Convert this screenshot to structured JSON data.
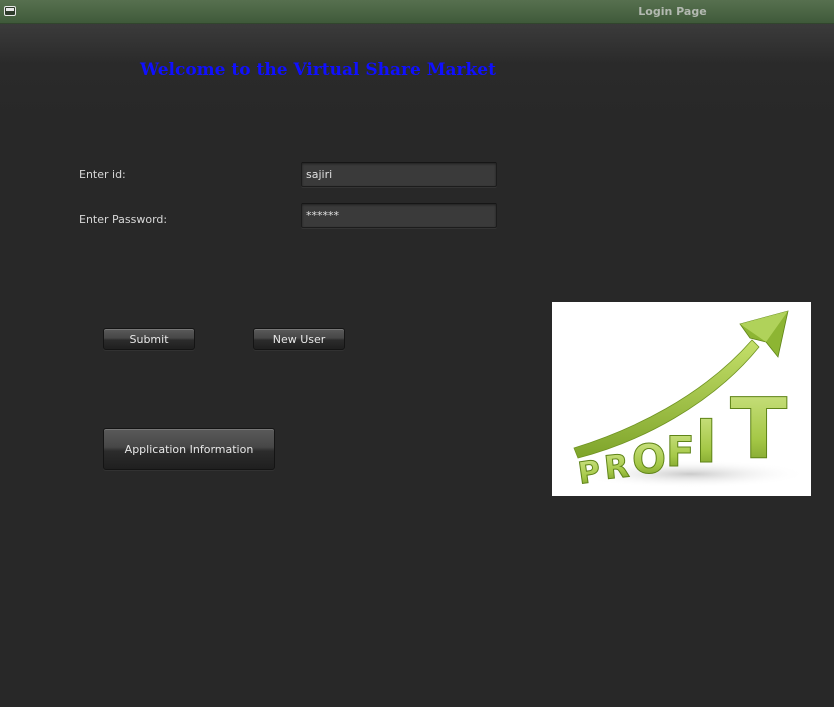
{
  "window": {
    "title": "Login Page",
    "icon": "window-icon"
  },
  "header": {
    "welcome_text": "Welcome to the Virtual Share Market",
    "welcome_color": "#1010ff"
  },
  "form": {
    "id_label": "Enter id:",
    "id_value": "sajiri",
    "password_label": "Enter Password:",
    "password_value": "******"
  },
  "buttons": {
    "submit_label": "Submit",
    "new_user_label": "New User",
    "app_info_label": "Application Information"
  },
  "image": {
    "word": "PROFIT",
    "letters": [
      "P",
      "R",
      "O",
      "F",
      "I",
      "T"
    ],
    "description_icon": "profit-growth-arrow-image",
    "accent_color": "#9fc43d"
  }
}
